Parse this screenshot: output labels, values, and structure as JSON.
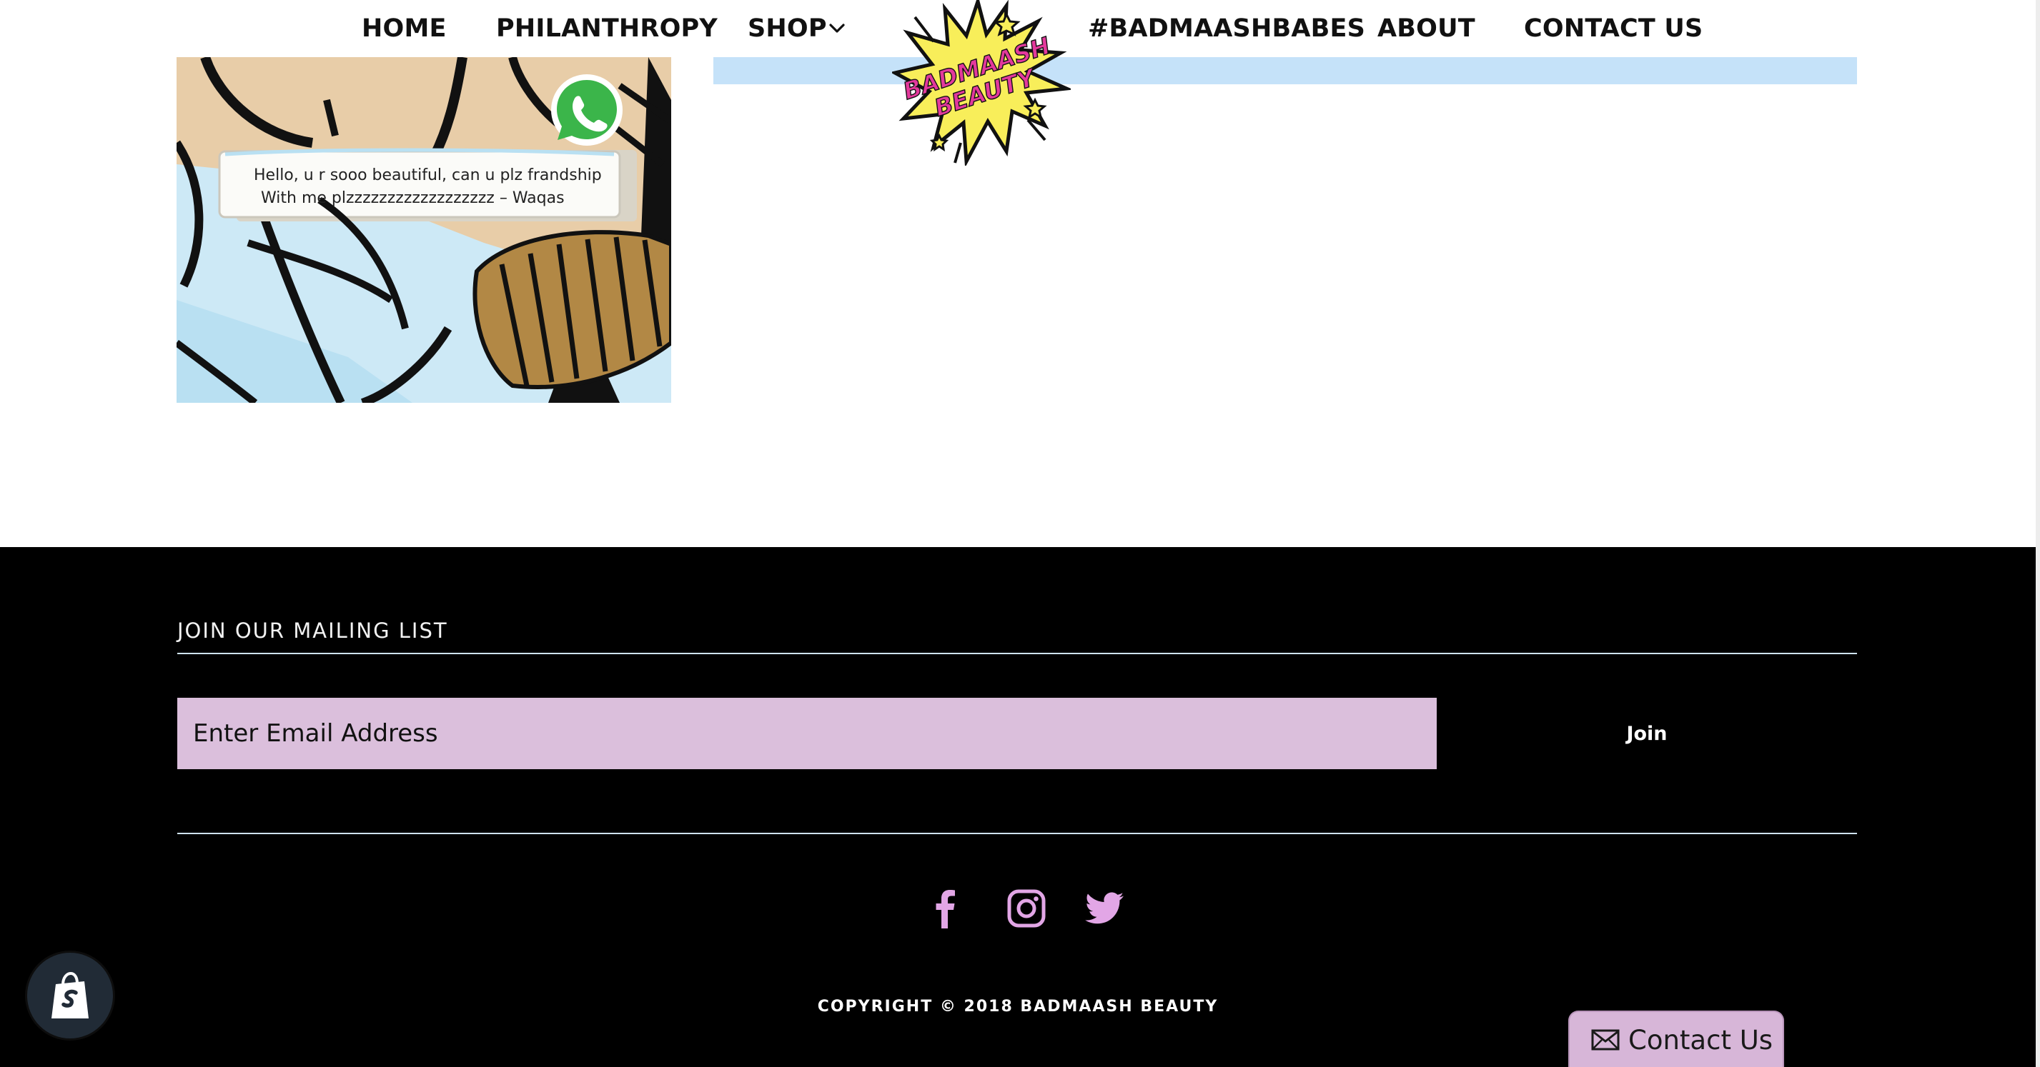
{
  "nav": {
    "items": [
      {
        "label": "HOME"
      },
      {
        "label": "PHILANTHROPY"
      },
      {
        "label": "SHOP"
      },
      {
        "label": "#BADMAASHBABES"
      },
      {
        "label": "ABOUT"
      },
      {
        "label": "CONTACT US"
      }
    ],
    "shop_icon": "chevron-down-icon",
    "logo": {
      "line1": "BADMAASH",
      "line2": "BEAUTY",
      "icon": "comic-burst-logo"
    }
  },
  "article": {
    "image_icon": "whatsapp-icon",
    "message_lines": [
      "Hello,  u r sooo beautiful, can u plz frandship",
      "With me plzzzzzzzzzzzzzzzzzz – Waqas"
    ]
  },
  "footer": {
    "mailing_title": "JOIN OUR MAILING LIST",
    "email_placeholder": "Enter Email Address",
    "join_label": "Join",
    "social_icons": [
      "facebook-icon",
      "instagram-icon",
      "twitter-icon"
    ],
    "copyright": "COPYRIGHT © 2018 BADMAASH BEAUTY"
  },
  "widgets": {
    "shopify_icon": "shopify-bag-icon",
    "contact_label": "Contact Us",
    "contact_icon": "envelope-icon"
  },
  "colors": {
    "accent_pink": "#d9b8da",
    "social_pink": "#e2a6e6",
    "highlight_blue": "#c5e2f9",
    "footer_bg": "#000000",
    "logo_yellow": "#f8ee5a",
    "logo_magenta": "#e3399c"
  }
}
